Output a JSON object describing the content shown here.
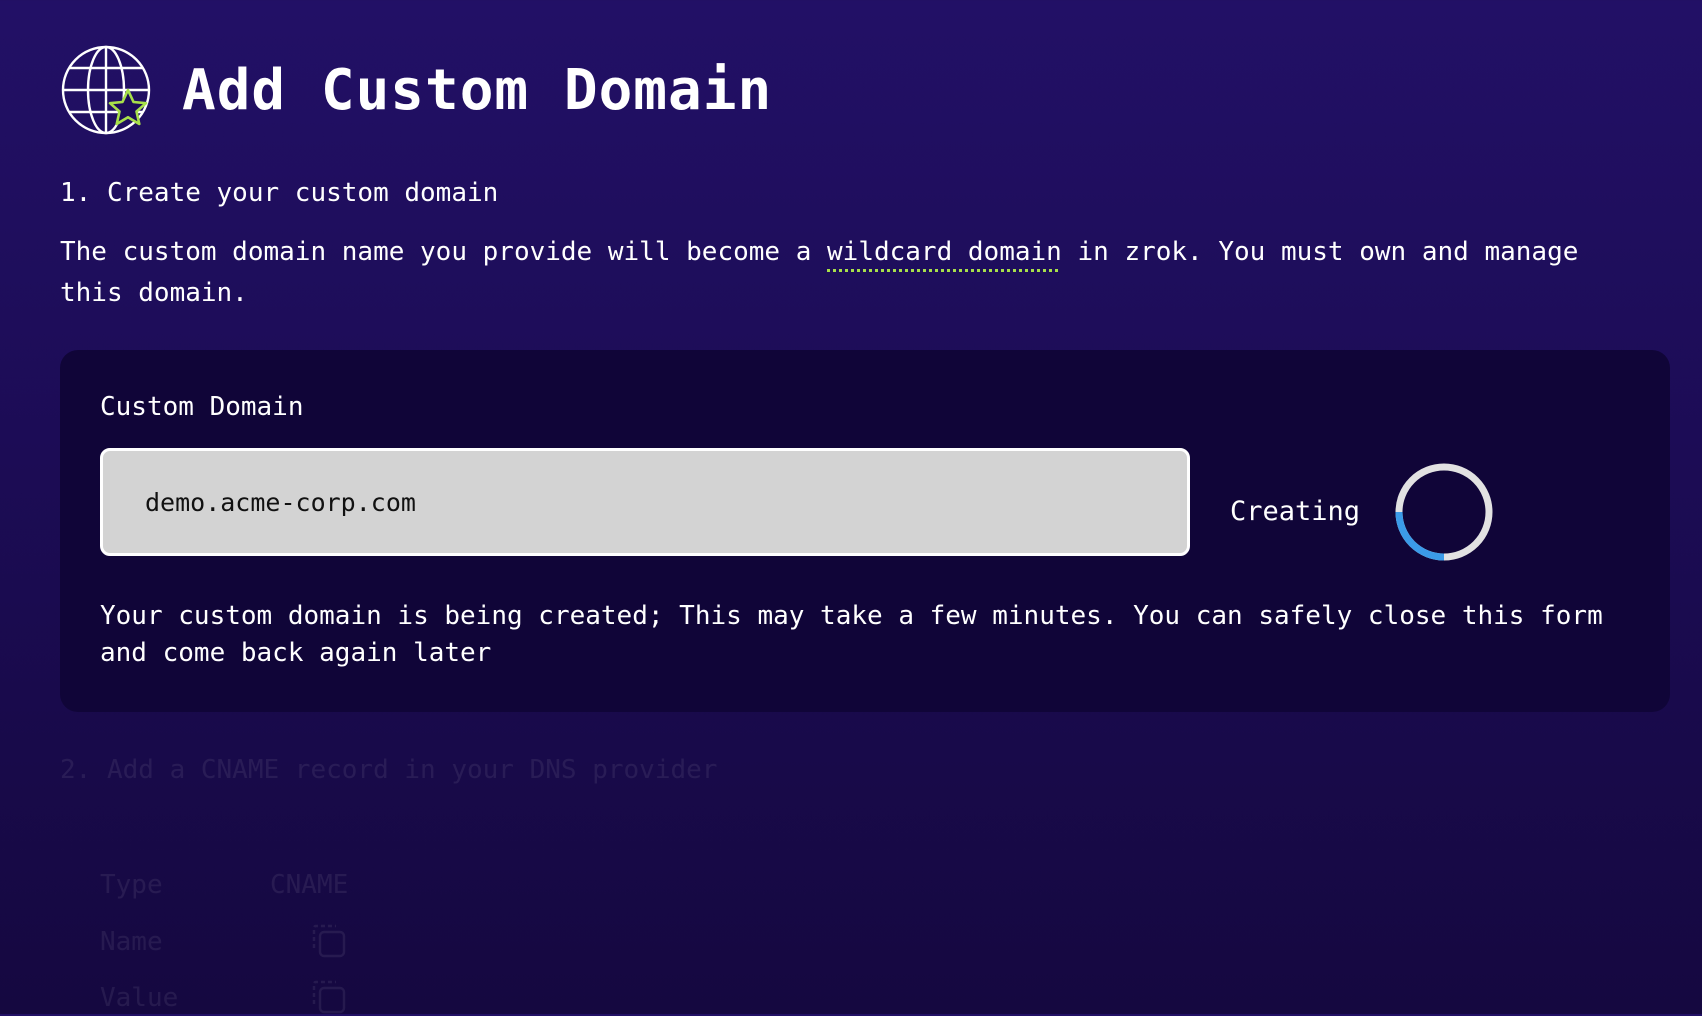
{
  "header": {
    "title": "Add Custom Domain",
    "icon": "globe-star-icon",
    "icon_star_color": "#a8e04a"
  },
  "step1": {
    "heading": "1. Create your custom domain",
    "description_before": "The custom domain name you provide will become a ",
    "description_term": "wildcard domain",
    "description_after": " in zrok. You must own and manage this domain."
  },
  "card": {
    "field_label": "Custom Domain",
    "input_value": "demo.acme-corp.com",
    "status_label": "Creating",
    "message": "Your custom domain is being created; This may take a few minutes. You can safely close this form and come back again later"
  },
  "step2": {
    "heading": "2. Add a CNAME record in your DNS provider",
    "rows": [
      {
        "label": "Type",
        "value": "CNAME"
      },
      {
        "label": "Name",
        "icon": "copy-icon"
      },
      {
        "label": "Value",
        "icon": "copy-icon"
      }
    ]
  },
  "colors": {
    "background_top": "#221066",
    "card_background": "#100538",
    "accent_green": "#a8e04a",
    "spinner_blue": "#3b9be8"
  }
}
